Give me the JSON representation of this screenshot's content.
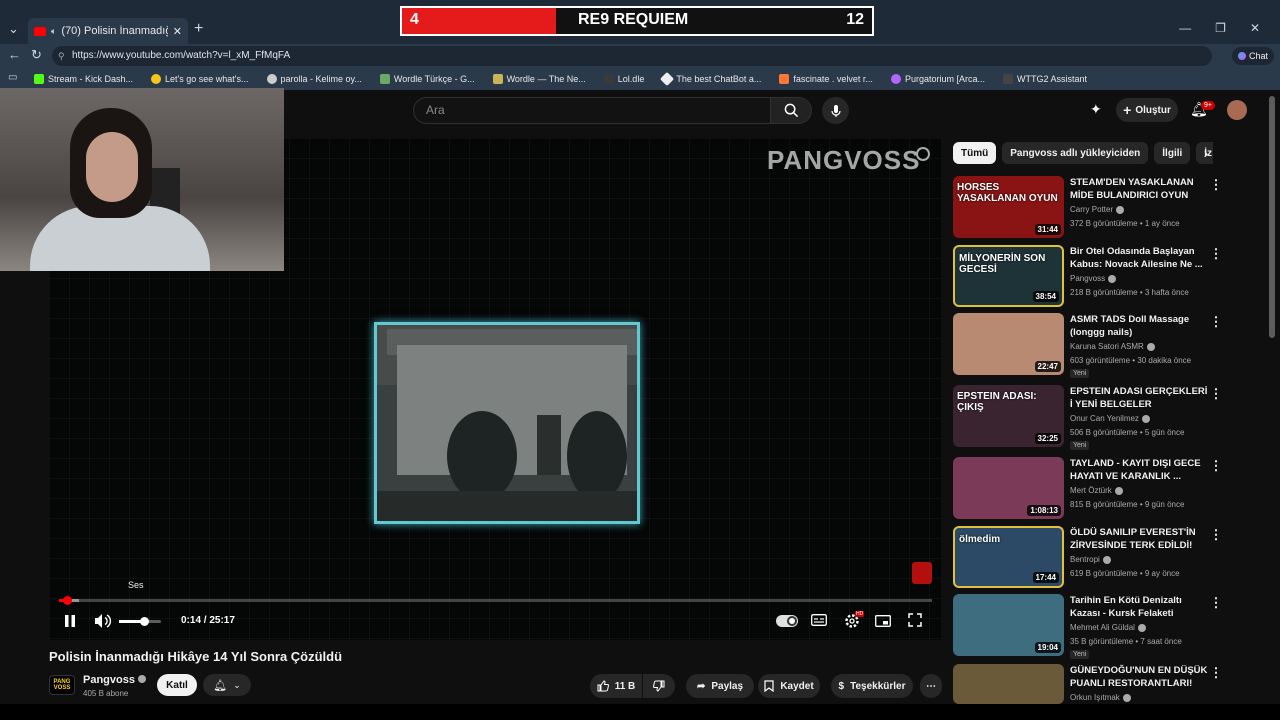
{
  "browser": {
    "tab_title": "(70) Polisin İnanmadığı Hikâye",
    "url": "https://www.youtube.com/watch?v=l_xM_FfMqFA",
    "profile_label": "Chat",
    "bookmarks": [
      {
        "label": "Stream - Kick Dash...",
        "color": "#53fc18"
      },
      {
        "label": "Let's go see what's...",
        "color": "#f5c518"
      },
      {
        "label": "parolla - Kelime oy...",
        "color": "#cccccc"
      },
      {
        "label": "Wordle Türkçe - G...",
        "color": "#6aaa64"
      },
      {
        "label": "Wordle — The Ne...",
        "color": "#c9b458"
      },
      {
        "label": "Lol.dle",
        "color": "#3a3a3a"
      },
      {
        "label": "The best ChatBot a...",
        "color": "#eeeeee"
      },
      {
        "label": "fascinate . velvet r...",
        "color": "#ff7733"
      },
      {
        "label": "Purgatorium [Arca...",
        "color": "#b066ff"
      },
      {
        "label": "WTTG2 Assistant",
        "color": "#444444"
      }
    ]
  },
  "overlay": {
    "left_score": "4",
    "game_name": "RE9 REQUIEM",
    "right_score": "12",
    "accent_color": "#e51b1b"
  },
  "header": {
    "search_placeholder": "Ara",
    "create_label": "Oluştur",
    "notifications_count": "9+"
  },
  "player": {
    "watermark": "PANGVOSS",
    "volume_tooltip": "Ses",
    "time_display": "0:14 / 25:17",
    "progress_fraction": 0.0092,
    "buffer_fraction": 0.023,
    "volume_fraction": 0.6
  },
  "video": {
    "title": "Polisin İnanmadığı Hikâye 14 Yıl Sonra Çözüldü",
    "channel": "Pangvoss",
    "channel_avatar_text": "PANG VOSS",
    "subscribers": "405 B abone",
    "join_label": "Katıl",
    "likes": "11 B",
    "share_label": "Paylaş",
    "save_label": "Kaydet",
    "thanks_label": "Teşekkürler"
  },
  "sidebar": {
    "chips": [
      "Tümü",
      "Pangvoss adlı yükleyiciden",
      "İlgili",
      "İz"
    ],
    "recommendations": [
      {
        "title": "STEAM'DEN YASAKLANAN MİDE BULANDIRICI OYUN",
        "channel": "Carry Potter",
        "verified": true,
        "meta": "372 B görüntüleme • 1 ay önce",
        "duration": "31:44",
        "thumb_text": "HORSES YASAKLANAN OYUN",
        "thumb_color": "#8a1414",
        "new": ""
      },
      {
        "title": "Bir Otel Odasında Başlayan Kabus: Novack Ailesine Ne ...",
        "channel": "Pangvoss",
        "verified": true,
        "meta": "218 B görüntüleme • 3 hafta önce",
        "duration": "38:54",
        "thumb_text": "MİLYONERİN SON GECESİ",
        "thumb_color": "#1e3338",
        "new": ""
      },
      {
        "title": "ASMR TADS Doll Massage (longgg nails)",
        "channel": "Karuna Satori ASMR",
        "verified": true,
        "meta": "603 görüntüleme • 30 dakika önce",
        "duration": "22:47",
        "thumb_text": "",
        "thumb_color": "#b88a72",
        "new": "Yeni"
      },
      {
        "title": "EPSTEIN ADASI GERÇEKLERİ İ YENİ BELGELER",
        "channel": "Onur Can Yenilmez",
        "verified": true,
        "meta": "506 B görüntüleme • 5 gün önce",
        "duration": "32:25",
        "thumb_text": "EPSTEIN ADASI: ÇIKIŞ",
        "thumb_color": "#3a2430",
        "new": "Yeni"
      },
      {
        "title": "TAYLAND - KAYIT DIŞI GECE HAYATI VE KARANLIK ...",
        "channel": "Mert Öztürk",
        "verified": true,
        "meta": "815 B görüntüleme • 9 gün önce",
        "duration": "1:08:13",
        "thumb_text": "",
        "thumb_color": "#7a3a58",
        "new": ""
      },
      {
        "title": "ÖLDÜ SANILIP EVEREST'İN ZİRVESİNDE TERK EDİLDİ!",
        "channel": "Bentropi",
        "verified": true,
        "meta": "619 B görüntüleme • 9 ay önce",
        "duration": "17:44",
        "thumb_text": "ölmedim",
        "thumb_color": "#2c4a66",
        "new": ""
      },
      {
        "title": "Tarihin En Kötü Denizaltı Kazası - Kursk Felaketi",
        "channel": "Mehmet Ali Güldal",
        "verified": true,
        "meta": "35 B görüntüleme • 7 saat önce",
        "duration": "19:04",
        "thumb_text": "",
        "thumb_color": "#3f6d80",
        "new": "Yeni"
      },
      {
        "title": "GÜNEYDOĞU'NUN EN DÜŞÜK PUANLI RESTORANTLARI!",
        "channel": "Orkun Işıtmak",
        "verified": true,
        "meta": "",
        "duration": "",
        "thumb_text": "",
        "thumb_color": "#6a5a3a",
        "new": ""
      }
    ]
  }
}
